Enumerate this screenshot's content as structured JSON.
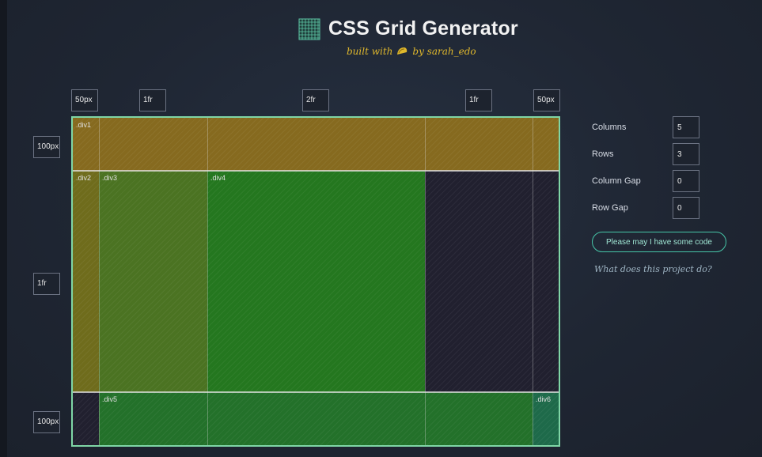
{
  "header": {
    "title": "CSS Grid Generator",
    "subtitle_prefix": "built with",
    "subtitle_suffix": "by sarah_edo"
  },
  "column_sizes": [
    "50px",
    "1fr",
    "2fr",
    "1fr",
    "50px"
  ],
  "row_sizes": [
    "100px",
    "1fr",
    "100px"
  ],
  "cells": {
    "div1": ".div1",
    "div2": ".div2",
    "div3": ".div3",
    "div4": ".div4",
    "div5": ".div5",
    "div6": ".div6"
  },
  "controls": {
    "columns_label": "Columns",
    "columns_value": "5",
    "rows_label": "Rows",
    "rows_value": "3",
    "column_gap_label": "Column Gap",
    "column_gap_value": "0",
    "row_gap_label": "Row Gap",
    "row_gap_value": "0"
  },
  "code_button_label": "Please may I have some code",
  "project_link": "What does this project do?",
  "colors": {
    "div1": "#866a1f",
    "div2": "#6f6c1c",
    "div3": "#4b7322",
    "div4": "#24771f",
    "div5": "#23712a",
    "div6": "#1e6a4a",
    "empty": "#21202f",
    "grid_border": "#7fd6a6",
    "accent": "#46c6a8",
    "subtitle": "#e0b82c"
  },
  "icons": {
    "logo": "grid-icon",
    "subtitle_symbol": "taco-icon"
  }
}
